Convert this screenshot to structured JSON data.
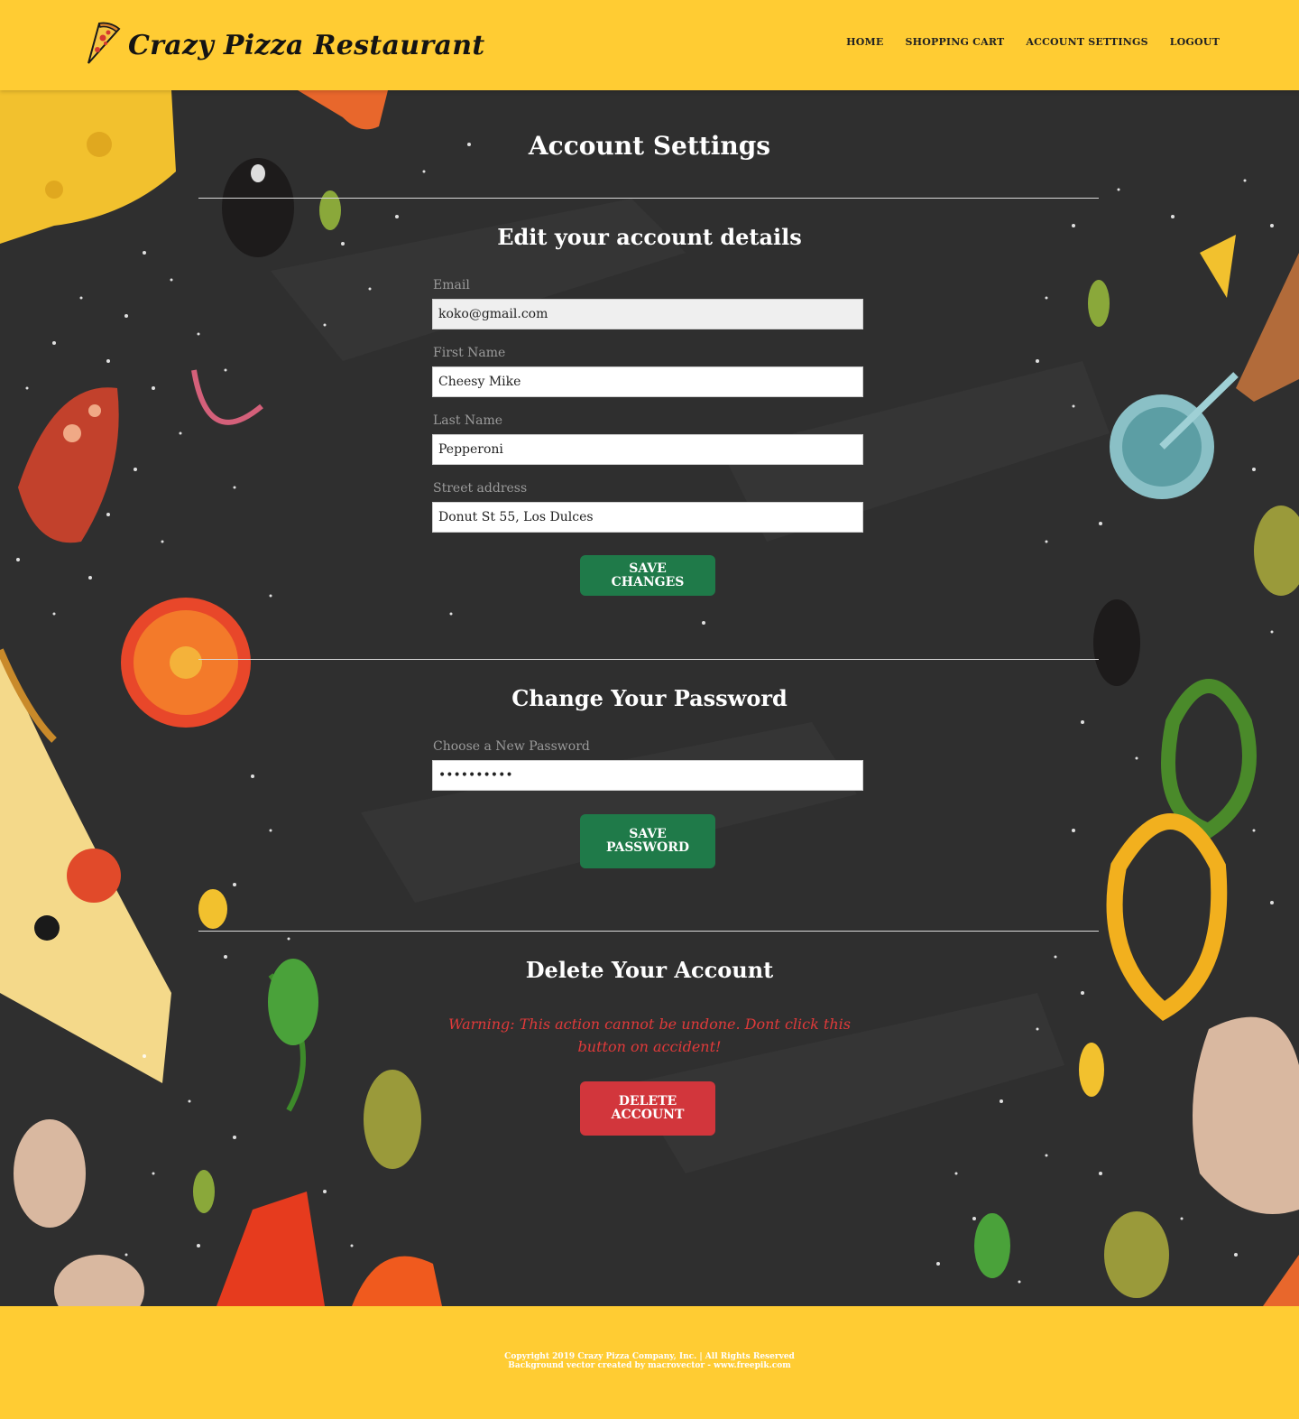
{
  "brand": {
    "title": "Crazy Pizza Restaurant",
    "logo_icon": "pizza-slice-icon"
  },
  "nav": {
    "items": [
      "HOME",
      "SHOPPING CART",
      "ACCOUNT SETTINGS",
      "LOGOUT"
    ]
  },
  "page": {
    "title": "Account Settings"
  },
  "account_details": {
    "heading": "Edit your account details",
    "email": {
      "label": "Email",
      "value": "koko@gmail.com"
    },
    "first_name": {
      "label": "First Name",
      "value": "Cheesy Mike"
    },
    "last_name": {
      "label": "Last Name",
      "value": "Pepperoni"
    },
    "street": {
      "label": "Street address",
      "value": "Donut St 55, Los Dulces"
    },
    "save_label": "SAVE CHANGES"
  },
  "password": {
    "heading": "Change Your Password",
    "label": "Choose a New Password",
    "value": "••••••••••",
    "save_label": "SAVE PASSWORD"
  },
  "delete": {
    "heading": "Delete Your Account",
    "warning": "Warning: This action cannot be undone. Dont click this button on accident!",
    "button_label": "DELETE ACCOUNT"
  },
  "footer": {
    "copyright": "Copyright 2019 Crazy Pizza Company, Inc. | All Rights Reserved",
    "credit": "Background vector created by macrovector - www.freepik.com"
  },
  "colors": {
    "header_bg": "#ffcc33",
    "main_bg": "#2f2f2f",
    "green_button": "#1f7a49",
    "red_button": "#d2363c",
    "warning_text": "#e03a3a"
  }
}
